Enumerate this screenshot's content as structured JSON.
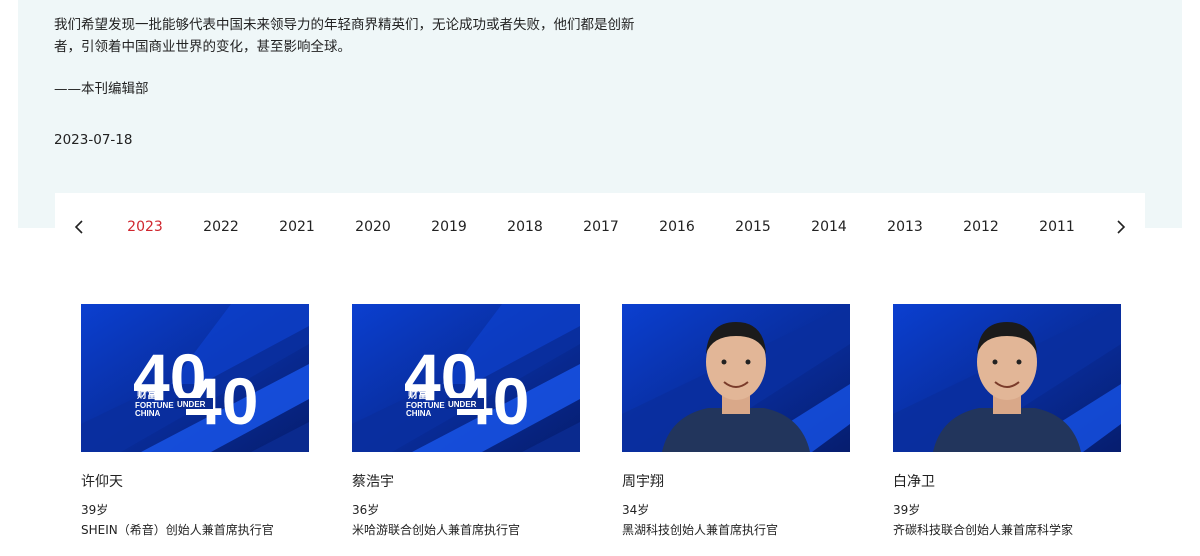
{
  "intro": {
    "paragraph": "我们希望发现一批能够代表中国未来领导力的年轻商界精英们，无论成功或者失败，他们都是创新者，引领着中国商业世界的变化，甚至影响全球。",
    "signature": "——本刊编辑部",
    "date": "2023-07-18"
  },
  "years": {
    "items": [
      "2023",
      "2022",
      "2021",
      "2020",
      "2019",
      "2018",
      "2017",
      "2016",
      "2015",
      "2014",
      "2013",
      "2012",
      "2011"
    ],
    "active": "2023"
  },
  "logo": {
    "number_left": "40",
    "number_right": "40",
    "under": "UNDER",
    "cn": "财富",
    "en_1": "FORTUNE",
    "en_2": "CHINA"
  },
  "cards": [
    {
      "name": "许仰天",
      "age": "39岁",
      "title": "SHEIN（希音）创始人兼首席执行官",
      "photo": "logo"
    },
    {
      "name": "蔡浩宇",
      "age": "36岁",
      "title": "米哈游联合创始人兼首席执行官",
      "photo": "logo"
    },
    {
      "name": "周宇翔",
      "age": "34岁",
      "title": "黑湖科技创始人兼首席执行官",
      "photo": "portrait"
    },
    {
      "name": "白净卫",
      "age": "39岁",
      "title": "齐碳科技联合创始人兼首席科学家",
      "photo": "portrait"
    }
  ],
  "colors": {
    "active_year": "#d0262e",
    "intro_bg": "#eff7f8",
    "card_blue": "#0a2a8e"
  },
  "icons": {
    "prev": "chevron-left-icon",
    "next": "chevron-right-icon"
  }
}
